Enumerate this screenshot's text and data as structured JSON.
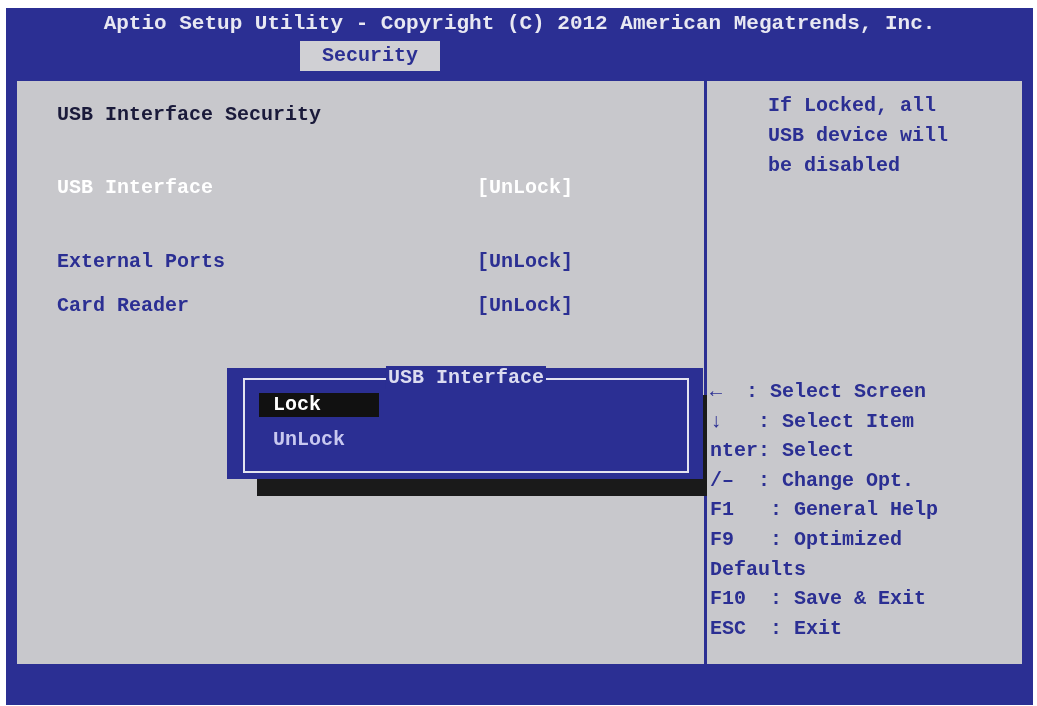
{
  "window": {
    "title": "Aptio Setup Utility - Copyright (C) 2012 American Megatrends, Inc."
  },
  "tabs": [
    {
      "label": "Security",
      "selected": true
    }
  ],
  "settings": [
    {
      "kind": "heading",
      "label": "USB Interface Security"
    },
    {
      "kind": "option",
      "label": "USB Interface",
      "value": "[UnLock]",
      "selected": true
    },
    {
      "kind": "option",
      "label": "External Ports",
      "value": "[UnLock]",
      "selected": false
    },
    {
      "kind": "option",
      "label": "Card Reader",
      "value": "[UnLock]",
      "selected": false
    }
  ],
  "help": {
    "description": "If Locked, all USB device will be disabled",
    "keys": [
      "←  : Select Screen",
      "↓   : Select Item",
      "nter: Select",
      "/–  : Change Opt.",
      "F1   : General Help",
      "F9   : Optimized",
      "Defaults",
      "F10  : Save & Exit",
      "ESC  : Exit"
    ]
  },
  "popup": {
    "title": "USB Interface",
    "options": [
      {
        "label": "Lock",
        "selected": true
      },
      {
        "label": "UnLock",
        "selected": false
      }
    ]
  }
}
